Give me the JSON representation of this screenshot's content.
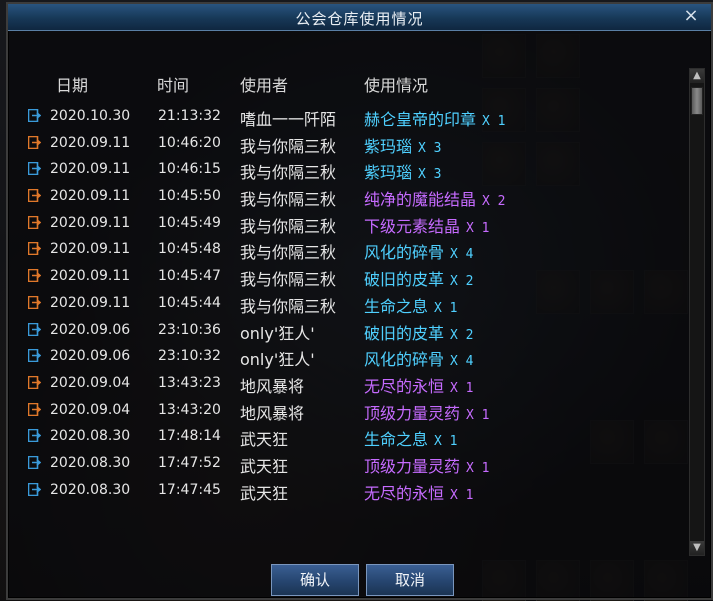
{
  "dialog": {
    "title": "公会仓库使用情况",
    "close_label": "×",
    "confirm_label": "确认",
    "cancel_label": "取消"
  },
  "table": {
    "headers": {
      "date": "日期",
      "time": "时间",
      "user": "使用者",
      "usage": "使用情况"
    },
    "rows": [
      {
        "type": "in",
        "date": "2020.10.30",
        "time": "21:13:32",
        "user": "嗜血一一阡陌",
        "item": "赫仑皇帝的印章",
        "qty": "X 1",
        "item_color": "#4fd0ff"
      },
      {
        "type": "out",
        "date": "2020.09.11",
        "time": "10:46:20",
        "user": "我与你隔三秋",
        "item": "紫玛瑙",
        "qty": "X 3",
        "item_color": "#4fd0ff"
      },
      {
        "type": "in",
        "date": "2020.09.11",
        "time": "10:46:15",
        "user": "我与你隔三秋",
        "item": "紫玛瑙",
        "qty": "X 3",
        "item_color": "#4fd0ff"
      },
      {
        "type": "out",
        "date": "2020.09.11",
        "time": "10:45:50",
        "user": "我与你隔三秋",
        "item": "纯净的魔能结晶",
        "qty": "X 2",
        "item_color": "#c66bff"
      },
      {
        "type": "out",
        "date": "2020.09.11",
        "time": "10:45:49",
        "user": "我与你隔三秋",
        "item": "下级元素结晶",
        "qty": "X 1",
        "item_color": "#c66bff"
      },
      {
        "type": "out",
        "date": "2020.09.11",
        "time": "10:45:48",
        "user": "我与你隔三秋",
        "item": "风化的碎骨",
        "qty": "X 4",
        "item_color": "#4fd0ff"
      },
      {
        "type": "out",
        "date": "2020.09.11",
        "time": "10:45:47",
        "user": "我与你隔三秋",
        "item": "破旧的皮革",
        "qty": "X 2",
        "item_color": "#4fd0ff"
      },
      {
        "type": "out",
        "date": "2020.09.11",
        "time": "10:45:44",
        "user": "我与你隔三秋",
        "item": "生命之息",
        "qty": "X 1",
        "item_color": "#4fd0ff"
      },
      {
        "type": "in",
        "date": "2020.09.06",
        "time": "23:10:36",
        "user": "only'狂人'",
        "item": "破旧的皮革",
        "qty": "X 2",
        "item_color": "#4fd0ff"
      },
      {
        "type": "in",
        "date": "2020.09.06",
        "time": "23:10:32",
        "user": "only'狂人'",
        "item": "风化的碎骨",
        "qty": "X 4",
        "item_color": "#4fd0ff"
      },
      {
        "type": "out",
        "date": "2020.09.04",
        "time": "13:43:23",
        "user": "地风暴将",
        "item": "无尽的永恒",
        "qty": "X 1",
        "item_color": "#c66bff"
      },
      {
        "type": "out",
        "date": "2020.09.04",
        "time": "13:43:20",
        "user": "地风暴将",
        "item": "顶级力量灵药",
        "qty": "X 1",
        "item_color": "#c66bff"
      },
      {
        "type": "in",
        "date": "2020.08.30",
        "time": "17:48:14",
        "user": "武天狂",
        "item": "生命之息",
        "qty": "X 1",
        "item_color": "#4fd0ff"
      },
      {
        "type": "in",
        "date": "2020.08.30",
        "time": "17:47:52",
        "user": "武天狂",
        "item": "顶级力量灵药",
        "qty": "X 1",
        "item_color": "#c66bff"
      },
      {
        "type": "in",
        "date": "2020.08.30",
        "time": "17:47:45",
        "user": "武天狂",
        "item": "无尽的永恒",
        "qty": "X 1",
        "item_color": "#c66bff"
      }
    ]
  },
  "colors": {
    "deposit_icon": "#3a9ad9",
    "withdraw_icon": "#e0782a",
    "qty_text": "#e0e0ff"
  },
  "icons": {
    "deposit": "deposit-icon",
    "withdraw": "withdraw-icon"
  }
}
